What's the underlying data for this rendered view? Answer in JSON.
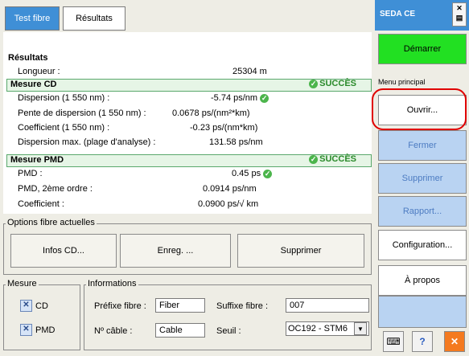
{
  "tabs": {
    "test_fibre": "Test fibre",
    "resultats": "Résultats"
  },
  "results": {
    "title": "Résultats",
    "longueur_label": "Longueur :",
    "longueur_value": "25304 m",
    "cd": {
      "header": "Mesure CD",
      "status": "SUCCÈS",
      "rows": [
        {
          "label": "Dispersion (1 550 nm) :",
          "value": "-5.74 ps/nm"
        },
        {
          "label": "Pente de dispersion (1 550 nm) :",
          "value": "0.0678 ps/(nm²*km)"
        },
        {
          "label": "Coefficient (1 550 nm) :",
          "value": "-0.23 ps/(nm*km)"
        },
        {
          "label": "Dispersion max. (plage d'analyse) :",
          "value": "131.58 ps/nm"
        }
      ]
    },
    "pmd": {
      "header": "Mesure PMD",
      "status": "SUCCÈS",
      "rows": [
        {
          "label": "PMD :",
          "value": "0.45 ps"
        },
        {
          "label": "PMD, 2ème ordre :",
          "value": "0.0914 ps/nm"
        },
        {
          "label": "Coefficient :",
          "value": "0.0900 ps/√ km"
        }
      ]
    }
  },
  "options": {
    "legend": "Options fibre actuelles",
    "infos_cd": "Infos CD...",
    "enreg": "Enreg. ...",
    "supprimer": "Supprimer"
  },
  "mesure": {
    "legend": "Mesure",
    "cd": "CD",
    "pmd": "PMD"
  },
  "informations": {
    "legend": "Informations",
    "prefixe_label": "Préfixe fibre :",
    "prefixe_value": "Fiber",
    "suffixe_label": "Suffixe fibre :",
    "suffixe_value": "007",
    "cable_label": "Nº câble :",
    "cable_value": "Cable",
    "seuil_label": "Seuil :",
    "seuil_value": "OC192 - STM6"
  },
  "right_panel": {
    "title": "SEDA CE",
    "demarrer": "Démarrer",
    "menu_label": "Menu principal",
    "ouvrir": "Ouvrir...",
    "fermer": "Fermer",
    "supprimer": "Supprimer",
    "rapport": "Rapport...",
    "configuration": "Configuration...",
    "a_propos": "À propos"
  },
  "colors": {
    "accent": "#3f8fd6",
    "success": "#2a8a2a",
    "highlight": "#e00000",
    "start": "#22e022"
  }
}
